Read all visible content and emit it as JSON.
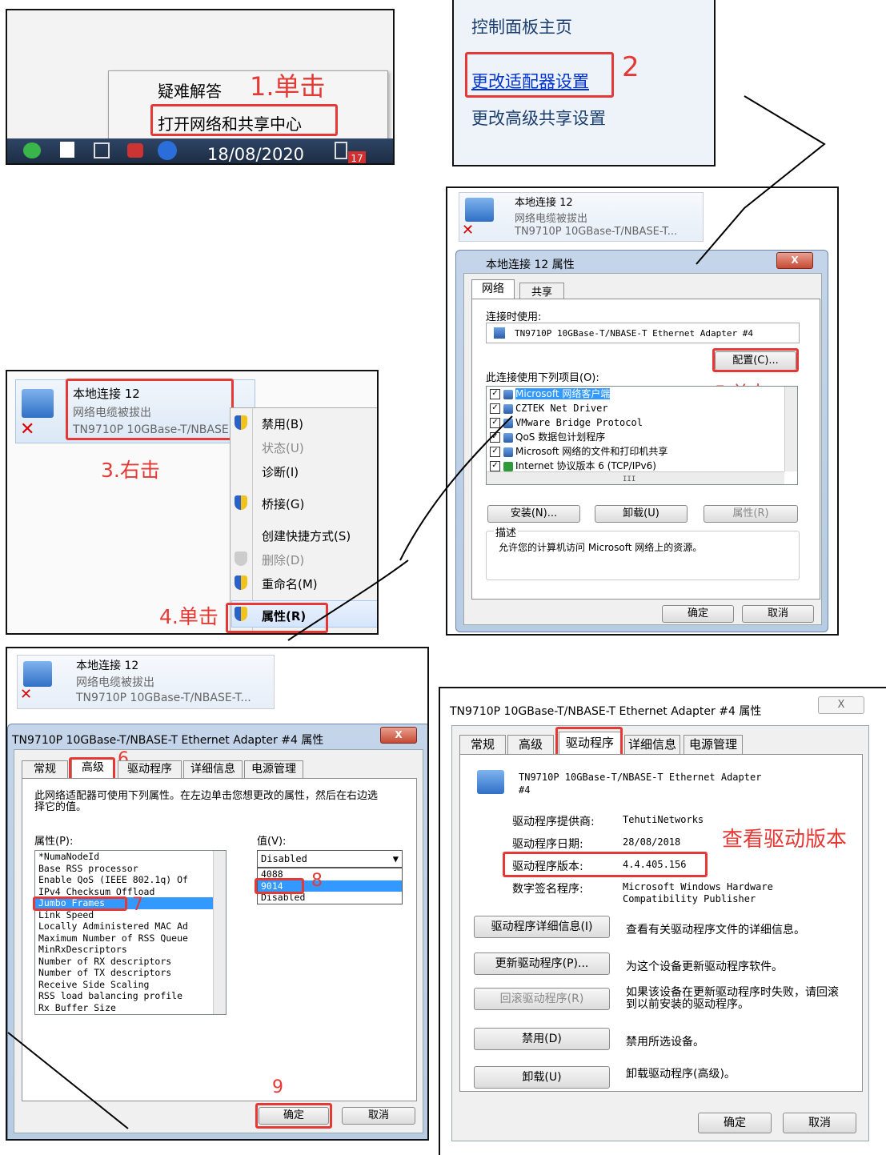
{
  "panel1": {
    "menu_items": [
      "疑难解答",
      "打开网络和共享中心"
    ],
    "annotation": "1.单击",
    "date": "18/08/2020",
    "badge": "17"
  },
  "panel2": {
    "links": [
      "控制面板主页",
      "更改适配器设置",
      "更改高级共享设置"
    ],
    "annotation": "2"
  },
  "adapter_card": {
    "name": "本地连接 12",
    "status": "网络电缆被拔出",
    "device": "TN9710P 10GBase-T/NBASE-T...",
    "device_truncated": "TN9710P 10GBase-T/NBASE"
  },
  "panel3": {
    "menu": [
      "禁用(B)",
      "状态(U)",
      "诊断(I)",
      "桥接(G)",
      "创建快捷方式(S)",
      "删除(D)",
      "重命名(M)",
      "属性(R)"
    ],
    "annotation_right": "3.右击",
    "annotation_click": "4.单击"
  },
  "panel4": {
    "title": "本地连接 12 属性",
    "close": "X",
    "tabs": [
      "网络",
      "共享"
    ],
    "connect_using_label": "连接时使用:",
    "adapter": "TN9710P 10GBase-T/NBASE-T Ethernet Adapter #4",
    "configure_button": "配置(C)...",
    "annotation": "5.单击",
    "items_label": "此连接使用下列项目(O):",
    "items": [
      "Microsoft 网络客户端",
      "CZTEK Net Driver",
      "VMware Bridge Protocol",
      "QoS 数据包计划程序",
      "Microsoft 网络的文件和打印机共享",
      "Internet 协议版本 6 (TCP/IPv6)"
    ],
    "scroll_mark": "III",
    "buttons": [
      "安装(N)...",
      "卸载(U)",
      "属性(R)"
    ],
    "description_label": "描述",
    "description": "允许您的计算机访问 Microsoft 网络上的资源。",
    "ok": "确定",
    "cancel": "取消"
  },
  "panel5": {
    "title": "TN9710P 10GBase-T/NBASE-T Ethernet Adapter #4 属性",
    "close": "X",
    "tabs": [
      "常规",
      "高级",
      "驱动程序",
      "详细信息",
      "电源管理"
    ],
    "annotation_tab": "6",
    "intro": "此网络适配器可使用下列属性。在左边单击您想更改的属性，然后在右边选择它的值。",
    "property_label": "属性(P):",
    "value_label": "值(V):",
    "properties": [
      "*NumaNodeId",
      "Base RSS processor",
      "Enable QoS (IEEE 802.1q) Of",
      "IPv4 Checksum Offload",
      "Jumbo Frames",
      "Link Speed",
      "Locally Administered MAC Ad",
      "Maximum Number of RSS Queue",
      "MinRxDescriptors",
      "Number of RX descriptors",
      "Number of TX descriptors",
      "Receive Side Scaling",
      "RSS load balancing profile",
      "Rx Buffer Size"
    ],
    "selected_value": "Disabled",
    "options": [
      "4088",
      "9014",
      "Disabled"
    ],
    "annotation_prop": "7",
    "annotation_value": "8",
    "annotation_ok": "9",
    "ok": "确定",
    "cancel": "取消"
  },
  "panel6": {
    "title": "TN9710P 10GBase-T/NBASE-T Ethernet Adapter #4 属性",
    "close": "X",
    "tabs": [
      "常规",
      "高级",
      "驱动程序",
      "详细信息",
      "电源管理"
    ],
    "device_name": "TN9710P 10GBase-T/NBASE-T Ethernet Adapter",
    "device_name_line2": "#4",
    "fields": [
      {
        "label": "驱动程序提供商:",
        "value": "TehutiNetworks"
      },
      {
        "label": "驱动程序日期:",
        "value": "28/08/2018"
      },
      {
        "label": "驱动程序版本:",
        "value": "4.4.405.156"
      },
      {
        "label": "数字签名程序:",
        "value": "Microsoft Windows Hardware"
      }
    ],
    "signer_line2": "Compatibility Publisher",
    "annotation": "查看驱动版本",
    "actions": [
      {
        "button": "驱动程序详细信息(I)",
        "desc": "查看有关驱动程序文件的详细信息。"
      },
      {
        "button": "更新驱动程序(P)...",
        "desc": "为这个设备更新驱动程序软件。"
      },
      {
        "button": "回滚驱动程序(R)",
        "desc": "如果该设备在更新驱动程序时失败，请回滚到以前安装的驱动程序。"
      },
      {
        "button": "禁用(D)",
        "desc": "禁用所选设备。"
      },
      {
        "button": "卸载(U)",
        "desc": "卸载驱动程序(高级)。"
      }
    ],
    "ok": "确定",
    "cancel": "取消"
  },
  "colors": {
    "annotation": "#e53935",
    "selection": "#3399ff"
  }
}
